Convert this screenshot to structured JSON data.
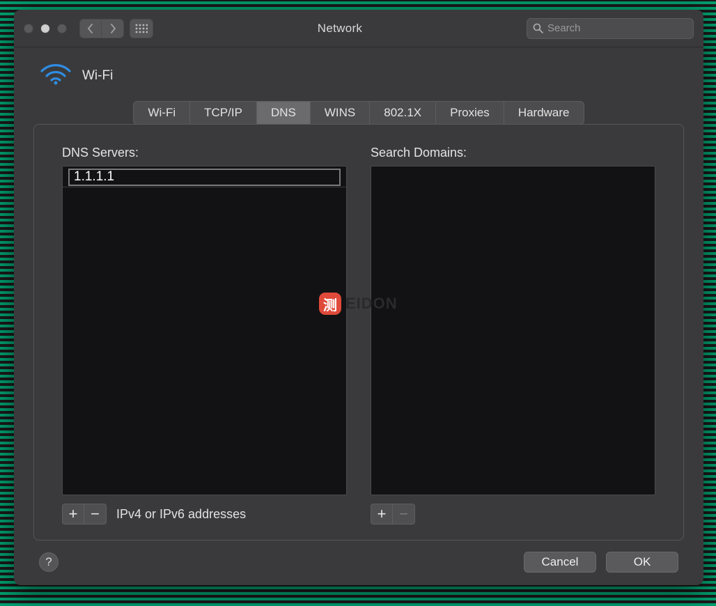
{
  "window": {
    "title": "Network"
  },
  "search": {
    "placeholder": "Search"
  },
  "header": {
    "label": "Wi-Fi"
  },
  "tabs": [
    {
      "label": "Wi-Fi",
      "selected": false
    },
    {
      "label": "TCP/IP",
      "selected": false
    },
    {
      "label": "DNS",
      "selected": true
    },
    {
      "label": "WINS",
      "selected": false
    },
    {
      "label": "802.1X",
      "selected": false
    },
    {
      "label": "Proxies",
      "selected": false
    },
    {
      "label": "Hardware",
      "selected": false
    }
  ],
  "dns": {
    "servers_label": "DNS Servers:",
    "servers": [
      "1.1.1.1"
    ],
    "editing_index": 0,
    "hint": "IPv4 or IPv6 addresses",
    "domains_label": "Search Domains:",
    "domains": []
  },
  "buttons": {
    "add": "+",
    "remove": "−",
    "cancel": "Cancel",
    "ok": "OK",
    "help": "?"
  },
  "watermark": {
    "badge": "测",
    "text": "EIDON"
  }
}
